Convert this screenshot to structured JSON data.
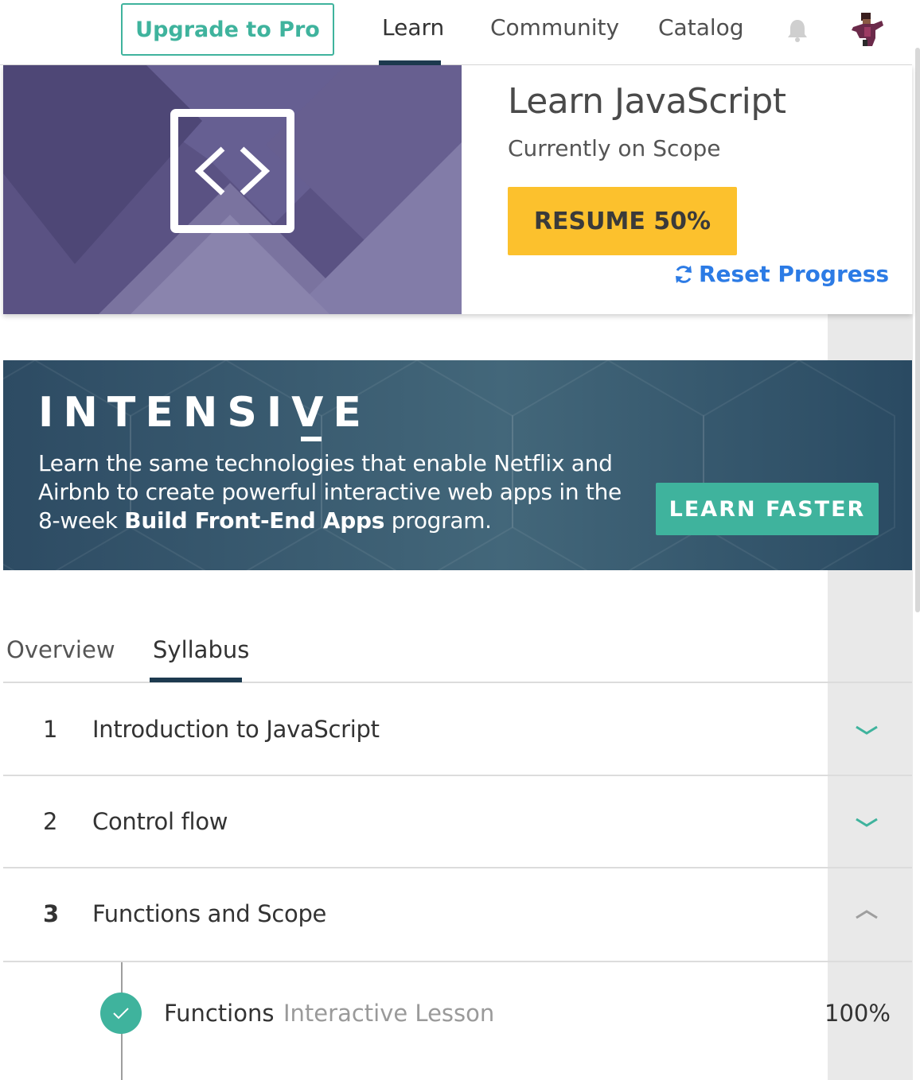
{
  "nav": {
    "upgrade_label": "Upgrade to Pro",
    "items": [
      {
        "label": "Learn",
        "active": true
      },
      {
        "label": "Community"
      },
      {
        "label": "Catalog"
      }
    ],
    "bell_icon": "bell-icon",
    "avatar_icon": "user-avatar"
  },
  "course": {
    "title": "Learn JavaScript",
    "subtitle": "Currently on Scope",
    "resume_label": "RESUME 50%",
    "reset_label": "Reset Progress",
    "image_icon": "code-brackets-icon",
    "image_color": "#5c5485"
  },
  "banner": {
    "title": "INTENSIVE",
    "text_part1": "Learn the same technologies that enable Netflix and Airbnb to create powerful interactive web apps in the 8-week ",
    "text_bold": "Build Front-End Apps",
    "text_part2": " program.",
    "cta_label": "LEARN FASTER"
  },
  "tabs": [
    {
      "label": "Overview"
    },
    {
      "label": "Syllabus",
      "active": true
    }
  ],
  "syllabus": [
    {
      "number": "1",
      "title": "Introduction to JavaScript",
      "expanded": false
    },
    {
      "number": "2",
      "title": "Control flow",
      "expanded": false
    },
    {
      "number": "3",
      "title": "Functions and Scope",
      "expanded": true
    }
  ],
  "lessons": [
    {
      "name": "Functions",
      "type": "Interactive Lesson",
      "progress": "100%",
      "completed": true
    }
  ],
  "colors": {
    "accent_green": "#3fb39d",
    "resume_yellow": "#fcc12d",
    "link_blue": "#2c7be5",
    "nav_underline": "#1d3a4f"
  }
}
